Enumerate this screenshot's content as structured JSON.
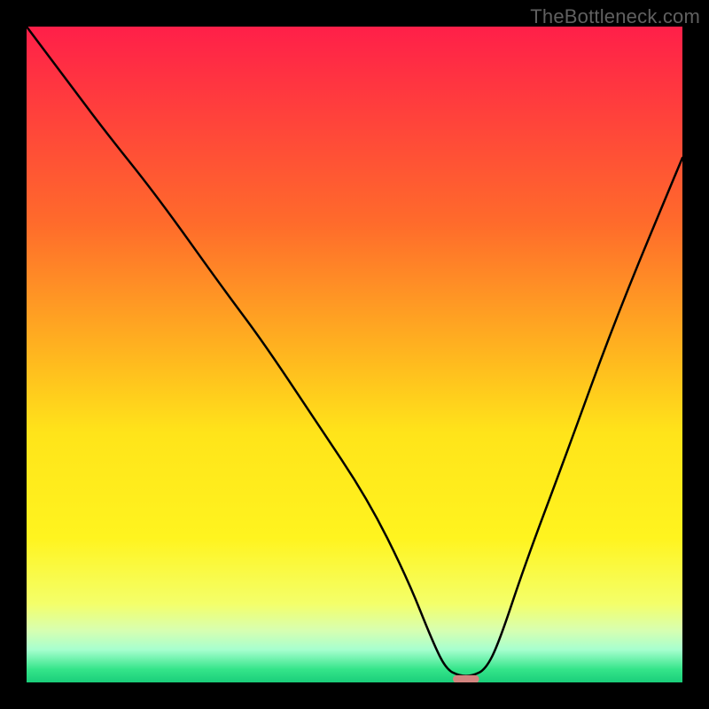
{
  "watermark": "TheBottleneck.com",
  "chart_data": {
    "type": "line",
    "title": "",
    "xlabel": "",
    "ylabel": "",
    "xlim": [
      0,
      100
    ],
    "ylim": [
      0,
      100
    ],
    "gradient_stops": [
      {
        "offset": 0.0,
        "color": "#ff1f49"
      },
      {
        "offset": 0.3,
        "color": "#ff6b2b"
      },
      {
        "offset": 0.5,
        "color": "#ffb61f"
      },
      {
        "offset": 0.62,
        "color": "#ffe41a"
      },
      {
        "offset": 0.78,
        "color": "#fff41f"
      },
      {
        "offset": 0.88,
        "color": "#f4ff6a"
      },
      {
        "offset": 0.92,
        "color": "#d8ffb0"
      },
      {
        "offset": 0.95,
        "color": "#a7ffcf"
      },
      {
        "offset": 0.98,
        "color": "#35e58a"
      },
      {
        "offset": 1.0,
        "color": "#1ace7a"
      }
    ],
    "series": [
      {
        "name": "bottleneck-curve",
        "x": [
          0,
          6,
          12,
          20,
          30,
          36,
          44,
          52,
          58,
          62,
          64,
          66,
          68,
          70,
          72,
          76,
          82,
          90,
          100
        ],
        "y": [
          100,
          92,
          84,
          74,
          60,
          52,
          40,
          28,
          16,
          6,
          2,
          1,
          1,
          2,
          6,
          18,
          34,
          56,
          80
        ]
      }
    ],
    "marker": {
      "name": "optimal-point",
      "x": 67,
      "y": 0.5,
      "width": 4,
      "height": 1.2,
      "color": "#d3847f"
    }
  }
}
